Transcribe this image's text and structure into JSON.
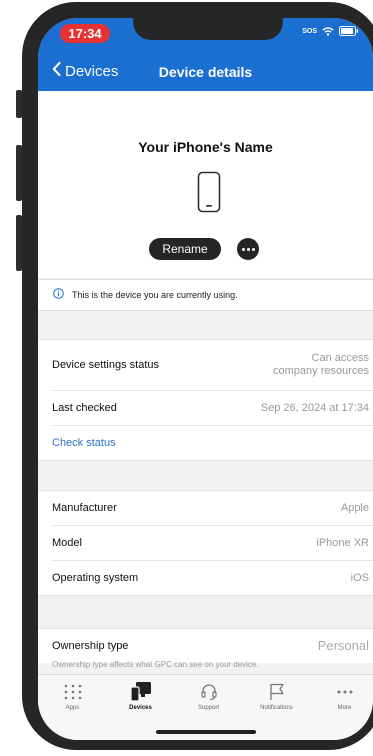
{
  "status_bar": {
    "time": "17:34",
    "carrier": "SOS"
  },
  "nav": {
    "back_label": "Devices",
    "title": "Device details"
  },
  "device": {
    "name": "Your iPhone's Name",
    "rename_label": "Rename"
  },
  "info_message": "This is the device you are currently using.",
  "status_group": {
    "settings_label": "Device settings status",
    "settings_value_line1": "Can access",
    "settings_value_line2": "company resources",
    "last_checked_label": "Last checked",
    "last_checked_value": "Sep 26, 2024 at 17:34",
    "check_status_label": "Check status"
  },
  "hardware_group": {
    "manufacturer_label": "Manufacturer",
    "manufacturer_value": "Apple",
    "model_label": "Model",
    "model_value": "iPhone XR",
    "os_label": "Operating system",
    "os_value": "iOS"
  },
  "ownership": {
    "label": "Ownership type",
    "value": "Personal",
    "note": "Ownership type affects what GPC can see on your device."
  },
  "tabs": [
    {
      "label": "Apps"
    },
    {
      "label": "Devices"
    },
    {
      "label": "Support"
    },
    {
      "label": "Notifications"
    },
    {
      "label": "More"
    }
  ],
  "colors": {
    "accent": "#1b6fd1",
    "link": "#2f6fc5",
    "time_pill": "#e63232"
  }
}
